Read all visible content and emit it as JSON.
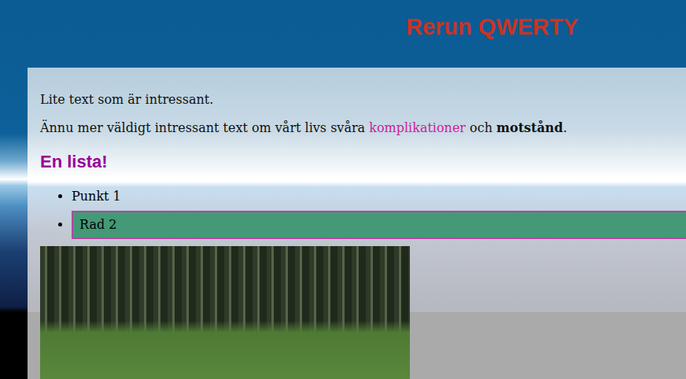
{
  "header": {
    "title": "Rerun QWERTY"
  },
  "paragraphs": [
    [
      {
        "text": "Lite text som är intressant.",
        "kind": "plain"
      }
    ],
    [
      {
        "text": "Ännu mer väldigt intressant text om vårt livs svåra ",
        "kind": "plain"
      },
      {
        "text": "komplikationer",
        "kind": "link"
      },
      {
        "text": " och ",
        "kind": "plain"
      },
      {
        "text": "motstånd",
        "kind": "strong"
      },
      {
        "text": ".",
        "kind": "plain"
      }
    ]
  ],
  "heading": "En lista!",
  "list": [
    {
      "text": "Punkt 1",
      "highlighted": false
    },
    {
      "text": "Rad 2",
      "highlighted": true
    }
  ]
}
